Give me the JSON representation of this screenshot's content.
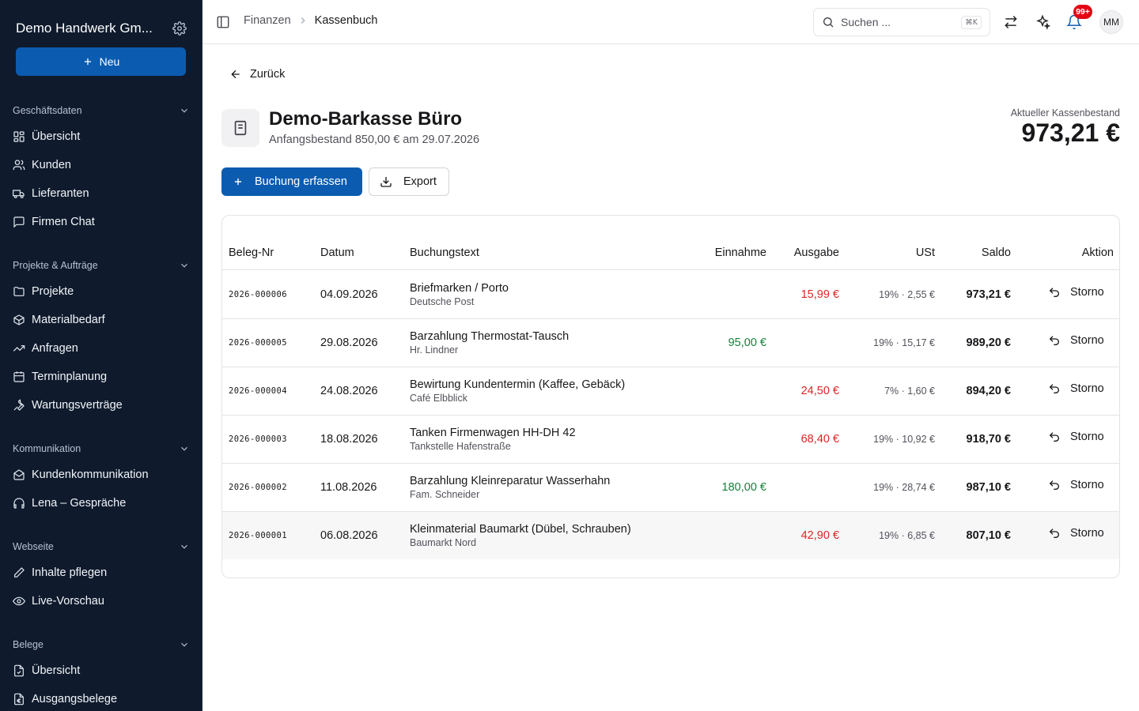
{
  "sidebar": {
    "company": "Demo Handwerk Gm...",
    "new_label": "Neu",
    "sections": [
      {
        "label": "Geschäftsdaten",
        "items": [
          {
            "label": "Übersicht",
            "icon": "dashboard-icon"
          },
          {
            "label": "Kunden",
            "icon": "users-icon"
          },
          {
            "label": "Lieferanten",
            "icon": "truck-icon"
          },
          {
            "label": "Firmen Chat",
            "icon": "chat-icon"
          }
        ]
      },
      {
        "label": "Projekte & Aufträge",
        "items": [
          {
            "label": "Projekte",
            "icon": "folder-icon"
          },
          {
            "label": "Materialbedarf",
            "icon": "package-icon"
          },
          {
            "label": "Anfragen",
            "icon": "trending-icon"
          },
          {
            "label": "Terminplanung",
            "icon": "calendar-icon"
          },
          {
            "label": "Wartungsverträge",
            "icon": "wrench-icon"
          }
        ]
      },
      {
        "label": "Kommunikation",
        "items": [
          {
            "label": "Kundenkommunikation",
            "icon": "mail-open-icon"
          },
          {
            "label": "Lena – Gespräche",
            "icon": "headphones-icon"
          }
        ]
      },
      {
        "label": "Webseite",
        "items": [
          {
            "label": "Inhalte pflegen",
            "icon": "pen-icon"
          },
          {
            "label": "Live-Vorschau",
            "icon": "eye-icon"
          }
        ]
      },
      {
        "label": "Belege",
        "items": [
          {
            "label": "Übersicht",
            "icon": "file-check-icon"
          },
          {
            "label": "Ausgangsbelege",
            "icon": "file-euro-icon"
          }
        ]
      }
    ]
  },
  "topbar": {
    "breadcrumb": [
      "Finanzen",
      "Kassenbuch"
    ],
    "search_placeholder": "Suchen ...",
    "search_shortcut": "⌘K",
    "notification_count": "99+",
    "avatar_initials": "MM"
  },
  "page": {
    "back_label": "Zurück",
    "title": "Demo-Barkasse Büro",
    "subtitle": "Anfangsbestand 850,00 € am 29.07.2026",
    "balance_label": "Aktueller Kassenbestand",
    "balance_value": "973,21 €",
    "primary_action": "Buchung erfassen",
    "export_label": "Export"
  },
  "table": {
    "headers": {
      "beleg": "Beleg-Nr",
      "datum": "Datum",
      "text": "Buchungstext",
      "einnahme": "Einnahme",
      "ausgabe": "Ausgabe",
      "ust": "USt",
      "saldo": "Saldo",
      "aktion": "Aktion"
    },
    "rows": [
      {
        "beleg": "2026-000006",
        "datum": "04.09.2026",
        "text": "Briefmarken / Porto",
        "sub": "Deutsche Post",
        "einnahme": "",
        "ausgabe": "15,99 €",
        "ust": "19% · 2,55 €",
        "saldo": "973,21 €",
        "aktion": "Storno"
      },
      {
        "beleg": "2026-000005",
        "datum": "29.08.2026",
        "text": "Barzahlung Thermostat-Tausch",
        "sub": "Hr. Lindner",
        "einnahme": "95,00 €",
        "ausgabe": "",
        "ust": "19% · 15,17 €",
        "saldo": "989,20 €",
        "aktion": "Storno"
      },
      {
        "beleg": "2026-000004",
        "datum": "24.08.2026",
        "text": "Bewirtung Kundentermin (Kaffee, Gebäck)",
        "sub": "Café Elbblick",
        "einnahme": "",
        "ausgabe": "24,50 €",
        "ust": "7% · 1,60 €",
        "saldo": "894,20 €",
        "aktion": "Storno"
      },
      {
        "beleg": "2026-000003",
        "datum": "18.08.2026",
        "text": "Tanken Firmenwagen HH-DH 42",
        "sub": "Tankstelle Hafenstraße",
        "einnahme": "",
        "ausgabe": "68,40 €",
        "ust": "19% · 10,92 €",
        "saldo": "918,70 €",
        "aktion": "Storno"
      },
      {
        "beleg": "2026-000002",
        "datum": "11.08.2026",
        "text": "Barzahlung Kleinreparatur Wasserhahn",
        "sub": "Fam. Schneider",
        "einnahme": "180,00 €",
        "ausgabe": "",
        "ust": "19% · 28,74 €",
        "saldo": "987,10 €",
        "aktion": "Storno"
      },
      {
        "beleg": "2026-000001",
        "datum": "06.08.2026",
        "text": "Kleinmaterial Baumarkt (Dübel, Schrauben)",
        "sub": "Baumarkt Nord",
        "einnahme": "",
        "ausgabe": "42,90 €",
        "ust": "19% · 6,85 €",
        "saldo": "807,10 €",
        "aktion": "Storno"
      }
    ]
  },
  "colors": {
    "sidebar_bg": "#0f1b2d",
    "primary": "#0b5cb0",
    "income": "#15803d",
    "expense": "#dc2626",
    "badge": "#e30613"
  }
}
